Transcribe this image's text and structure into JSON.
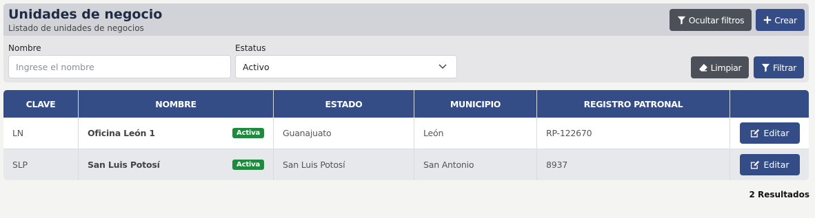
{
  "header": {
    "title": "Unidades de negocio",
    "subtitle": "Listado de unidades de negocios",
    "hide_filters_label": "Ocultar filtros",
    "create_label": "Crear"
  },
  "filters": {
    "name_label": "Nombre",
    "name_placeholder": "Ingrese el nombre",
    "status_label": "Estatus",
    "status_value": "Activo",
    "clear_label": "Limpiar",
    "filter_label": "Filtrar"
  },
  "table": {
    "columns": [
      "CLAVE",
      "NOMBRE",
      "ESTADO",
      "MUNICIPIO",
      "REGISTRO PATRONAL",
      ""
    ],
    "rows": [
      {
        "clave": "LN",
        "nombre": "Oficina León 1",
        "badge": "Activa",
        "estado": "Guanajuato",
        "municipio": "León",
        "registro": "RP-122670",
        "action": "Editar"
      },
      {
        "clave": "SLP",
        "nombre": "San Luis Potosí",
        "badge": "Activa",
        "estado": "San Luis Potosí",
        "municipio": "San Antonio",
        "registro": "8937",
        "action": "Editar"
      }
    ]
  },
  "footer": {
    "results": "2 Resultados"
  },
  "colors": {
    "primary": "#354d86",
    "secondary": "#4b5059",
    "success": "#1d8a3e"
  },
  "icons": {
    "hide_filters": "filter-icon",
    "create": "plus-icon",
    "clear": "eraser-icon",
    "filter": "filter-icon",
    "edit": "edit-icon",
    "select": "chevron-down-icon"
  }
}
